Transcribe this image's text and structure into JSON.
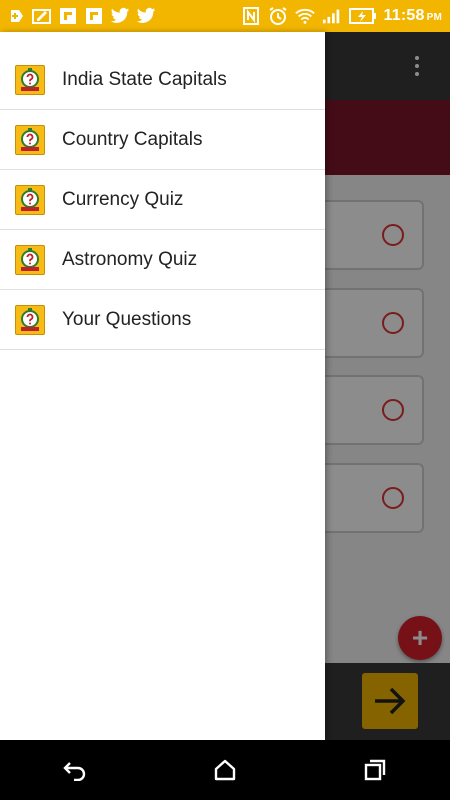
{
  "status_bar": {
    "time": "11:58",
    "ampm": "PM",
    "left_icons": [
      "add-box-icon",
      "edit-box-icon",
      "flipboard-icon",
      "flipboard-icon",
      "twitter-icon",
      "twitter-icon"
    ],
    "right_icons": [
      "nfc-icon",
      "alarm-icon",
      "wifi-icon",
      "signal-icon",
      "battery-charging-icon"
    ]
  },
  "drawer": {
    "items": [
      {
        "label": "India State Capitals",
        "icon": "quiz-clock-icon"
      },
      {
        "label": "Country Capitals",
        "icon": "quiz-clock-icon"
      },
      {
        "label": "Currency Quiz",
        "icon": "quiz-clock-icon"
      },
      {
        "label": "Astronomy Quiz",
        "icon": "quiz-clock-icon"
      },
      {
        "label": "Your Questions",
        "icon": "quiz-clock-icon"
      }
    ]
  },
  "colors": {
    "status_bar": "#f3b600",
    "toolbar": "#3a3a3a",
    "banner": "#7c1728",
    "accent": "#d8202d",
    "next_button": "#f3b600"
  },
  "nav_bar": {
    "buttons": [
      "back-icon",
      "home-icon",
      "recents-icon"
    ]
  }
}
